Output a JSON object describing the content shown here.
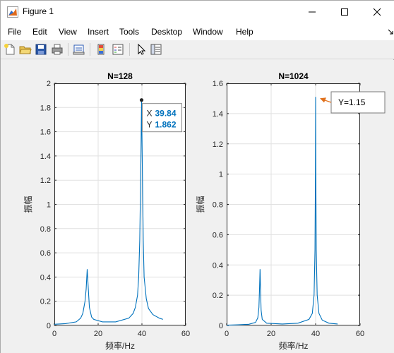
{
  "window": {
    "title": "Figure 1"
  },
  "menu": [
    "File",
    "Edit",
    "View",
    "Insert",
    "Tools",
    "Desktop",
    "Window",
    "Help"
  ],
  "toolbar_icons": [
    "new-figure-icon",
    "open-file-icon",
    "save-icon",
    "print-icon",
    "print-preview-icon",
    "insert-colorbar-icon",
    "insert-legend-icon",
    "edit-plot-cursor-icon",
    "property-inspector-icon"
  ],
  "colors": {
    "line": "#0072bd",
    "accent": "#1a6fd6",
    "datatip_text": "#0072bd"
  },
  "chart_data": [
    {
      "type": "line",
      "title": "N=128",
      "xlabel": "频率/Hz",
      "ylabel": "振幅",
      "xlim": [
        0,
        60
      ],
      "ylim": [
        0,
        2
      ],
      "xticks": [
        "0",
        "20",
        "40",
        "60"
      ],
      "yticks": [
        "0",
        "0.2",
        "0.4",
        "0.6",
        "0.8",
        "1",
        "1.2",
        "1.4",
        "1.6",
        "1.8",
        "2"
      ],
      "x": [
        0,
        5,
        10,
        12,
        13,
        14,
        14.5,
        15,
        15.5,
        16,
        17,
        18,
        22,
        28,
        34,
        36,
        37,
        38,
        38.5,
        39,
        39.5,
        39.84,
        40.2,
        40.6,
        41,
        42,
        43,
        45,
        48,
        49.6
      ],
      "y": [
        0.01,
        0.015,
        0.03,
        0.06,
        0.1,
        0.2,
        0.3,
        0.465,
        0.3,
        0.15,
        0.07,
        0.05,
        0.03,
        0.03,
        0.06,
        0.1,
        0.15,
        0.25,
        0.4,
        0.7,
        1.3,
        1.862,
        1.3,
        0.7,
        0.4,
        0.22,
        0.14,
        0.09,
        0.06,
        0.05
      ],
      "datatip": {
        "x_label": "X",
        "x_value": "39.84",
        "y_label": "Y",
        "y_value": "1.862"
      }
    },
    {
      "type": "line",
      "title": "N=1024",
      "xlabel": "频率/Hz",
      "ylabel": "振幅",
      "xlim": [
        0,
        60
      ],
      "ylim": [
        0,
        1.6
      ],
      "xticks": [
        "0",
        "20",
        "40",
        "60"
      ],
      "yticks": [
        "0",
        "0.2",
        "0.4",
        "0.6",
        "0.8",
        "1",
        "1.2",
        "1.4",
        "1.6"
      ],
      "x": [
        0,
        5,
        10,
        13,
        14,
        14.5,
        14.8,
        15,
        15.2,
        15.5,
        16,
        18,
        25,
        32,
        37,
        38.5,
        39.3,
        39.7,
        39.9,
        40,
        40.1,
        40.3,
        40.7,
        41.5,
        43,
        46,
        49.9
      ],
      "y": [
        0.002,
        0.004,
        0.008,
        0.02,
        0.05,
        0.12,
        0.25,
        0.372,
        0.25,
        0.1,
        0.04,
        0.015,
        0.01,
        0.015,
        0.04,
        0.08,
        0.2,
        0.5,
        1.0,
        1.51,
        1.0,
        0.5,
        0.2,
        0.08,
        0.035,
        0.015,
        0.01
      ],
      "annotation": "Y=1.15"
    }
  ]
}
